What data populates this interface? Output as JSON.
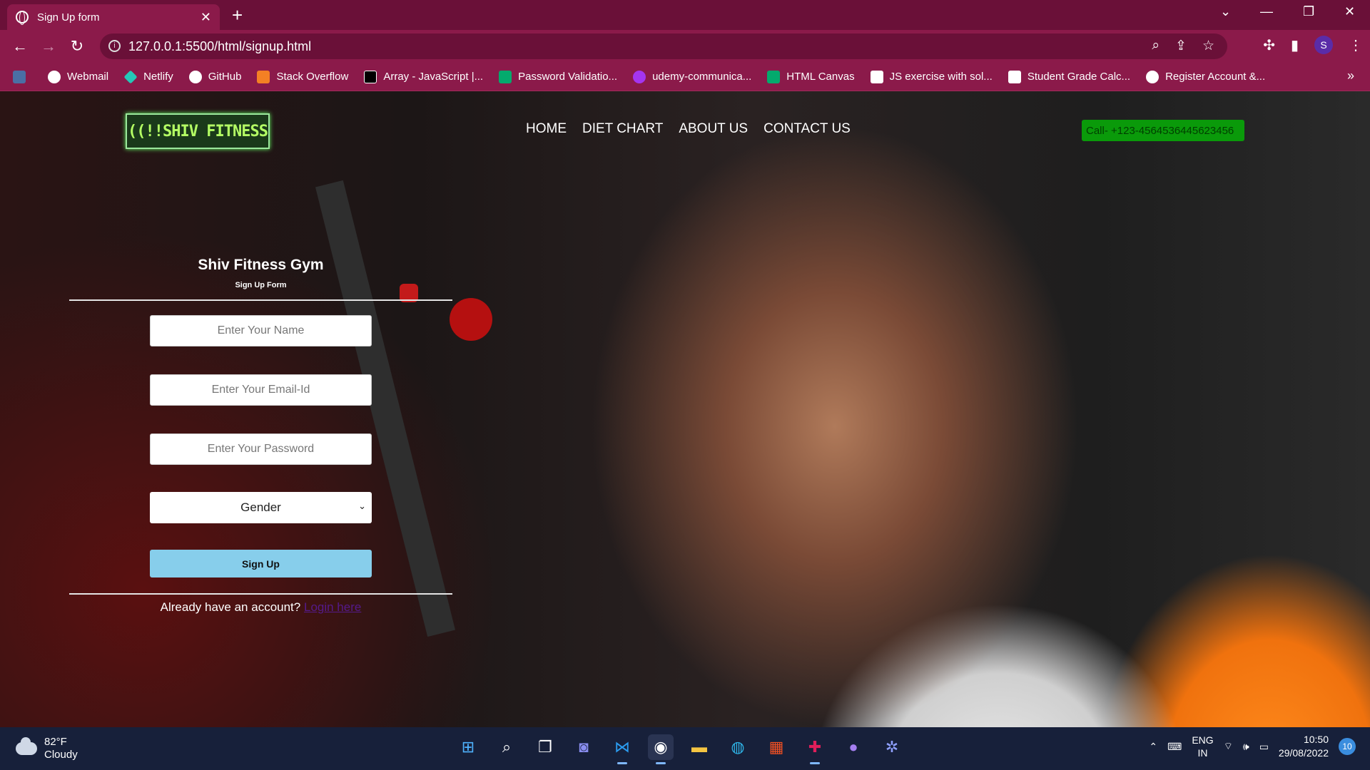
{
  "browser": {
    "tab_title": "Sign Up form",
    "new_tab": "+",
    "url": "127.0.0.1:5500/html/signup.html",
    "profile_initial": "S",
    "bookmarks": [
      {
        "label": "Webmail",
        "color": "#ffffff"
      },
      {
        "label": "Netlify",
        "color": "#25c7b7"
      },
      {
        "label": "GitHub",
        "color": "#ffffff"
      },
      {
        "label": "Stack Overflow",
        "color": "#f48024"
      },
      {
        "label": "Array - JavaScript |...",
        "color": "#000000"
      },
      {
        "label": "Password Validatio...",
        "color": "#04aa6d"
      },
      {
        "label": "udemy-communica...",
        "color": "#a435f0"
      },
      {
        "label": "HTML Canvas",
        "color": "#04aa6d"
      },
      {
        "label": "JS exercise with sol...",
        "color": "#ffffff"
      },
      {
        "label": "Student Grade Calc...",
        "color": "#ffffff"
      },
      {
        "label": "Register Account &...",
        "color": "#ffffff"
      }
    ],
    "more": "»"
  },
  "site": {
    "logo": "((!!SHIV FITNESS",
    "nav": [
      "HOME",
      "DIET CHART",
      "ABOUT US",
      "CONTACT US"
    ],
    "call": "Call- +123-4564536445623456"
  },
  "form": {
    "title": "Shiv Fitness Gym",
    "subtitle": "Sign Up Form",
    "name_placeholder": "Enter Your Name",
    "email_placeholder": "Enter Your Email-Id",
    "password_placeholder": "Enter Your Password",
    "gender_label": "Gender",
    "submit": "Sign Up",
    "already_text": "Already have an account?",
    "login_link": "Login here"
  },
  "taskbar": {
    "temp": "82°F",
    "condition": "Cloudy",
    "lang_1": "ENG",
    "lang_2": "IN",
    "time": "10:50",
    "date": "29/08/2022",
    "notifications": "10"
  },
  "colors": {
    "browser_frame": "#8b1a4a",
    "call_bg": "#0a9a0a",
    "signup_bg": "#87ceeb",
    "logo_text": "#b4ff64"
  }
}
